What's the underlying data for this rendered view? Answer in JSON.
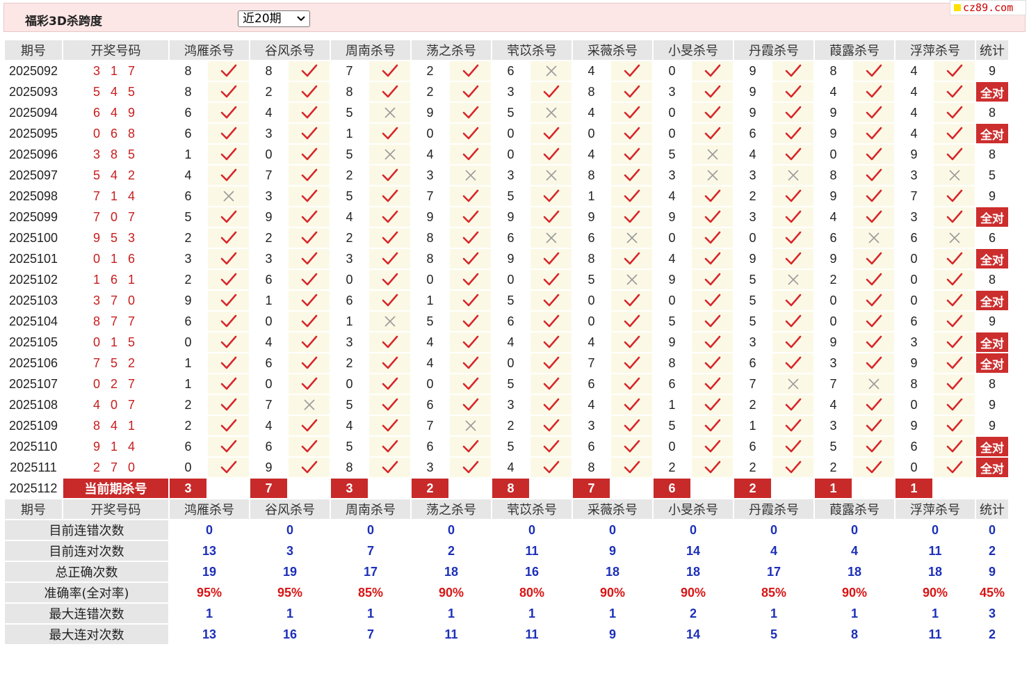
{
  "header": {
    "title": "福彩3D杀跨度",
    "period_select": "近20期",
    "site_logo": "cz89.com"
  },
  "table": {
    "columns": {
      "issue": "期号",
      "draw": "开奖号码",
      "predictors": [
        "鸿雁杀号",
        "谷风杀号",
        "周南杀号",
        "荡之杀号",
        "茕苡杀号",
        "采薇杀号",
        "小旻杀号",
        "丹霞杀号",
        "葭露杀号",
        "浮萍杀号"
      ],
      "stats": "统计"
    },
    "rows": [
      {
        "issue": "2025092",
        "draw": "3 1 7",
        "kills": [
          8,
          8,
          7,
          2,
          6,
          4,
          0,
          9,
          8,
          4
        ],
        "results": [
          1,
          1,
          1,
          1,
          0,
          1,
          1,
          1,
          1,
          1
        ],
        "stat": "9"
      },
      {
        "issue": "2025093",
        "draw": "5 4 5",
        "kills": [
          8,
          2,
          8,
          2,
          3,
          8,
          3,
          9,
          4,
          4
        ],
        "results": [
          1,
          1,
          1,
          1,
          1,
          1,
          1,
          1,
          1,
          1
        ],
        "stat": "全对"
      },
      {
        "issue": "2025094",
        "draw": "6 4 9",
        "kills": [
          6,
          4,
          5,
          9,
          5,
          4,
          0,
          9,
          9,
          4
        ],
        "results": [
          1,
          1,
          0,
          1,
          0,
          1,
          1,
          1,
          1,
          1
        ],
        "stat": "8"
      },
      {
        "issue": "2025095",
        "draw": "0 6 8",
        "kills": [
          6,
          3,
          1,
          0,
          0,
          0,
          0,
          6,
          9,
          4
        ],
        "results": [
          1,
          1,
          1,
          1,
          1,
          1,
          1,
          1,
          1,
          1
        ],
        "stat": "全对"
      },
      {
        "issue": "2025096",
        "draw": "3 8 5",
        "kills": [
          1,
          0,
          5,
          4,
          0,
          4,
          5,
          4,
          0,
          9
        ],
        "results": [
          1,
          1,
          0,
          1,
          1,
          1,
          0,
          1,
          1,
          1
        ],
        "stat": "8"
      },
      {
        "issue": "2025097",
        "draw": "5 4 2",
        "kills": [
          4,
          7,
          2,
          3,
          3,
          8,
          3,
          3,
          8,
          3
        ],
        "results": [
          1,
          1,
          1,
          0,
          0,
          1,
          0,
          0,
          1,
          0
        ],
        "stat": "5"
      },
      {
        "issue": "2025098",
        "draw": "7 1 4",
        "kills": [
          6,
          3,
          5,
          7,
          5,
          1,
          4,
          2,
          9,
          7
        ],
        "results": [
          0,
          1,
          1,
          1,
          1,
          1,
          1,
          1,
          1,
          1
        ],
        "stat": "9"
      },
      {
        "issue": "2025099",
        "draw": "7 0 7",
        "kills": [
          5,
          9,
          4,
          9,
          9,
          9,
          9,
          3,
          4,
          3
        ],
        "results": [
          1,
          1,
          1,
          1,
          1,
          1,
          1,
          1,
          1,
          1
        ],
        "stat": "全对"
      },
      {
        "issue": "2025100",
        "draw": "9 5 3",
        "kills": [
          2,
          2,
          2,
          8,
          6,
          6,
          0,
          0,
          6,
          6
        ],
        "results": [
          1,
          1,
          1,
          1,
          0,
          0,
          1,
          1,
          0,
          0
        ],
        "stat": "6"
      },
      {
        "issue": "2025101",
        "draw": "0 1 6",
        "kills": [
          3,
          3,
          3,
          8,
          9,
          8,
          4,
          9,
          9,
          0
        ],
        "results": [
          1,
          1,
          1,
          1,
          1,
          1,
          1,
          1,
          1,
          1
        ],
        "stat": "全对"
      },
      {
        "issue": "2025102",
        "draw": "1 6 1",
        "kills": [
          2,
          6,
          0,
          0,
          0,
          5,
          9,
          5,
          2,
          0
        ],
        "results": [
          1,
          1,
          1,
          1,
          1,
          0,
          1,
          0,
          1,
          1
        ],
        "stat": "8"
      },
      {
        "issue": "2025103",
        "draw": "3 7 0",
        "kills": [
          9,
          1,
          6,
          1,
          5,
          0,
          0,
          5,
          0,
          0
        ],
        "results": [
          1,
          1,
          1,
          1,
          1,
          1,
          1,
          1,
          1,
          1
        ],
        "stat": "全对"
      },
      {
        "issue": "2025104",
        "draw": "8 7 7",
        "kills": [
          6,
          0,
          1,
          5,
          6,
          0,
          5,
          5,
          0,
          6
        ],
        "results": [
          1,
          1,
          0,
          1,
          1,
          1,
          1,
          1,
          1,
          1
        ],
        "stat": "9"
      },
      {
        "issue": "2025105",
        "draw": "0 1 5",
        "kills": [
          0,
          4,
          3,
          4,
          4,
          4,
          9,
          3,
          9,
          3
        ],
        "results": [
          1,
          1,
          1,
          1,
          1,
          1,
          1,
          1,
          1,
          1
        ],
        "stat": "全对"
      },
      {
        "issue": "2025106",
        "draw": "7 5 2",
        "kills": [
          1,
          6,
          2,
          4,
          0,
          7,
          8,
          6,
          3,
          9
        ],
        "results": [
          1,
          1,
          1,
          1,
          1,
          1,
          1,
          1,
          1,
          1
        ],
        "stat": "全对"
      },
      {
        "issue": "2025107",
        "draw": "0 2 7",
        "kills": [
          1,
          0,
          0,
          0,
          5,
          6,
          6,
          7,
          7,
          8
        ],
        "results": [
          1,
          1,
          1,
          1,
          1,
          1,
          1,
          0,
          0,
          1
        ],
        "stat": "8"
      },
      {
        "issue": "2025108",
        "draw": "4 0 7",
        "kills": [
          2,
          7,
          5,
          6,
          3,
          4,
          1,
          2,
          4,
          0
        ],
        "results": [
          1,
          0,
          1,
          1,
          1,
          1,
          1,
          1,
          1,
          1
        ],
        "stat": "9"
      },
      {
        "issue": "2025109",
        "draw": "8 4 1",
        "kills": [
          2,
          4,
          4,
          7,
          2,
          3,
          5,
          1,
          3,
          9
        ],
        "results": [
          1,
          1,
          1,
          0,
          1,
          1,
          1,
          1,
          1,
          1
        ],
        "stat": "9"
      },
      {
        "issue": "2025110",
        "draw": "9 1 4",
        "kills": [
          6,
          6,
          5,
          6,
          5,
          6,
          0,
          6,
          5,
          6
        ],
        "results": [
          1,
          1,
          1,
          1,
          1,
          1,
          1,
          1,
          1,
          1
        ],
        "stat": "全对"
      },
      {
        "issue": "2025111",
        "draw": "2 7 0",
        "kills": [
          0,
          9,
          8,
          3,
          4,
          8,
          2,
          2,
          2,
          0
        ],
        "results": [
          1,
          1,
          1,
          1,
          1,
          1,
          1,
          1,
          1,
          1
        ],
        "stat": "全对"
      }
    ],
    "current": {
      "issue": "2025112",
      "label": "当前期杀号",
      "kills": [
        3,
        7,
        3,
        2,
        8,
        7,
        6,
        2,
        1,
        1
      ]
    },
    "footer_header": {
      "issue": "期号",
      "draw": "开奖号码",
      "predictors": [
        "鸿雁杀号",
        "谷风杀号",
        "周南杀号",
        "荡之杀号",
        "茕苡杀号",
        "采薇杀号",
        "小旻杀号",
        "丹霞杀号",
        "葭露杀号",
        "浮萍杀号"
      ],
      "stats": "统计"
    },
    "summary": [
      {
        "label": "目前连错次数",
        "values": [
          "0",
          "0",
          "0",
          "0",
          "0",
          "0",
          "0",
          "0",
          "0",
          "0",
          "0"
        ],
        "color": "blue"
      },
      {
        "label": "目前连对次数",
        "values": [
          "13",
          "3",
          "7",
          "2",
          "11",
          "9",
          "14",
          "4",
          "4",
          "11",
          "2"
        ],
        "color": "blue"
      },
      {
        "label": "总正确次数",
        "values": [
          "19",
          "19",
          "17",
          "18",
          "16",
          "18",
          "18",
          "17",
          "18",
          "18",
          "9"
        ],
        "color": "blue"
      },
      {
        "label": "准确率(全对率)",
        "values": [
          "95%",
          "95%",
          "85%",
          "90%",
          "80%",
          "90%",
          "90%",
          "85%",
          "90%",
          "90%",
          "45%"
        ],
        "color": "red"
      },
      {
        "label": "最大连错次数",
        "values": [
          "1",
          "1",
          "1",
          "1",
          "1",
          "1",
          "2",
          "1",
          "1",
          "1",
          "3"
        ],
        "color": "blue"
      },
      {
        "label": "最大连对次数",
        "values": [
          "13",
          "16",
          "7",
          "11",
          "11",
          "9",
          "14",
          "5",
          "8",
          "11",
          "2"
        ],
        "color": "blue"
      }
    ]
  },
  "icons": {
    "correct": "check-icon",
    "wrong": "cross-icon"
  },
  "colors": {
    "check": "#d8262b",
    "cross": "#9a9a9a",
    "draw_number": "#c81c1c",
    "full_badge": "#cc2d2d",
    "summary_blue": "#1c2fb8",
    "summary_red": "#d81515",
    "header_bg": "#fde6e6"
  }
}
